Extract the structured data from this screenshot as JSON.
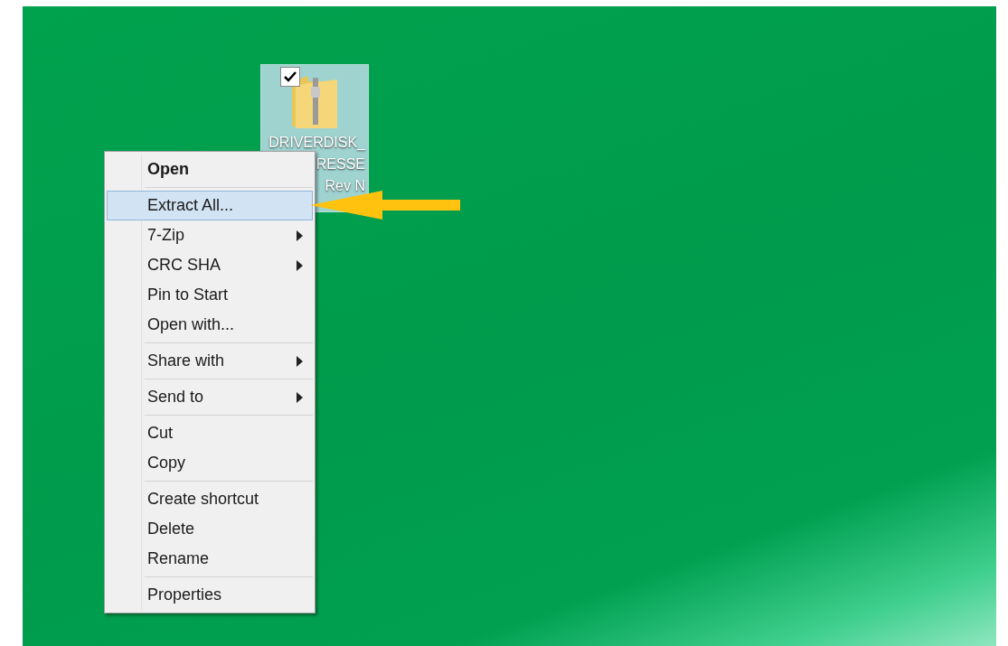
{
  "desktop_icon": {
    "checked": true,
    "selected": true,
    "label_lines": [
      "DRIVERDISK_",
      "RESSE",
      "Rev N"
    ]
  },
  "context_menu": {
    "items": [
      {
        "kind": "item",
        "label": "Open",
        "default": true,
        "submenu": false,
        "selected": false
      },
      {
        "kind": "separator"
      },
      {
        "kind": "item",
        "label": "Extract All...",
        "default": false,
        "submenu": false,
        "selected": true
      },
      {
        "kind": "item",
        "label": "7-Zip",
        "default": false,
        "submenu": true,
        "selected": false
      },
      {
        "kind": "item",
        "label": "CRC SHA",
        "default": false,
        "submenu": true,
        "selected": false
      },
      {
        "kind": "item",
        "label": "Pin to Start",
        "default": false,
        "submenu": false,
        "selected": false
      },
      {
        "kind": "item",
        "label": "Open with...",
        "default": false,
        "submenu": false,
        "selected": false
      },
      {
        "kind": "separator"
      },
      {
        "kind": "item",
        "label": "Share with",
        "default": false,
        "submenu": true,
        "selected": false
      },
      {
        "kind": "separator"
      },
      {
        "kind": "item",
        "label": "Send to",
        "default": false,
        "submenu": true,
        "selected": false
      },
      {
        "kind": "separator"
      },
      {
        "kind": "item",
        "label": "Cut",
        "default": false,
        "submenu": false,
        "selected": false
      },
      {
        "kind": "item",
        "label": "Copy",
        "default": false,
        "submenu": false,
        "selected": false
      },
      {
        "kind": "separator"
      },
      {
        "kind": "item",
        "label": "Create shortcut",
        "default": false,
        "submenu": false,
        "selected": false
      },
      {
        "kind": "item",
        "label": "Delete",
        "default": false,
        "submenu": false,
        "selected": false
      },
      {
        "kind": "item",
        "label": "Rename",
        "default": false,
        "submenu": false,
        "selected": false
      },
      {
        "kind": "separator"
      },
      {
        "kind": "item",
        "label": "Properties",
        "default": false,
        "submenu": false,
        "selected": false
      }
    ]
  }
}
